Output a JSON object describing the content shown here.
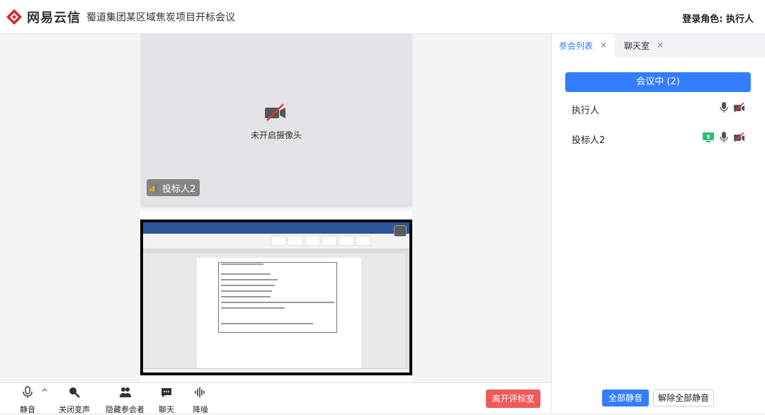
{
  "header": {
    "brand": "网易云信",
    "meeting_title": "蜀道集团某区域焦炭项目开标会议",
    "role": "登录角色: 执行人"
  },
  "stage": {
    "camera_off_label": "未开启摄像头",
    "video_name": "投标人2"
  },
  "toolbar": {
    "mute": "静音",
    "voice_change": "关闭变声",
    "hide_participants": "隐藏参会者",
    "chat": "聊天",
    "noise": "降噪",
    "leave": "离开评标室"
  },
  "panel": {
    "tabs": [
      {
        "label": "参会列表"
      },
      {
        "label": "聊天室"
      }
    ],
    "status": "会议中 (2)",
    "members": [
      {
        "name": "执行人"
      },
      {
        "name": "投标人2"
      }
    ],
    "mute_all": "全部静音",
    "unmute_all": "解除全部静音"
  },
  "colors": {
    "accent": "#337eff",
    "danger": "#f05a5a",
    "share_green": "#2dbd7a"
  }
}
